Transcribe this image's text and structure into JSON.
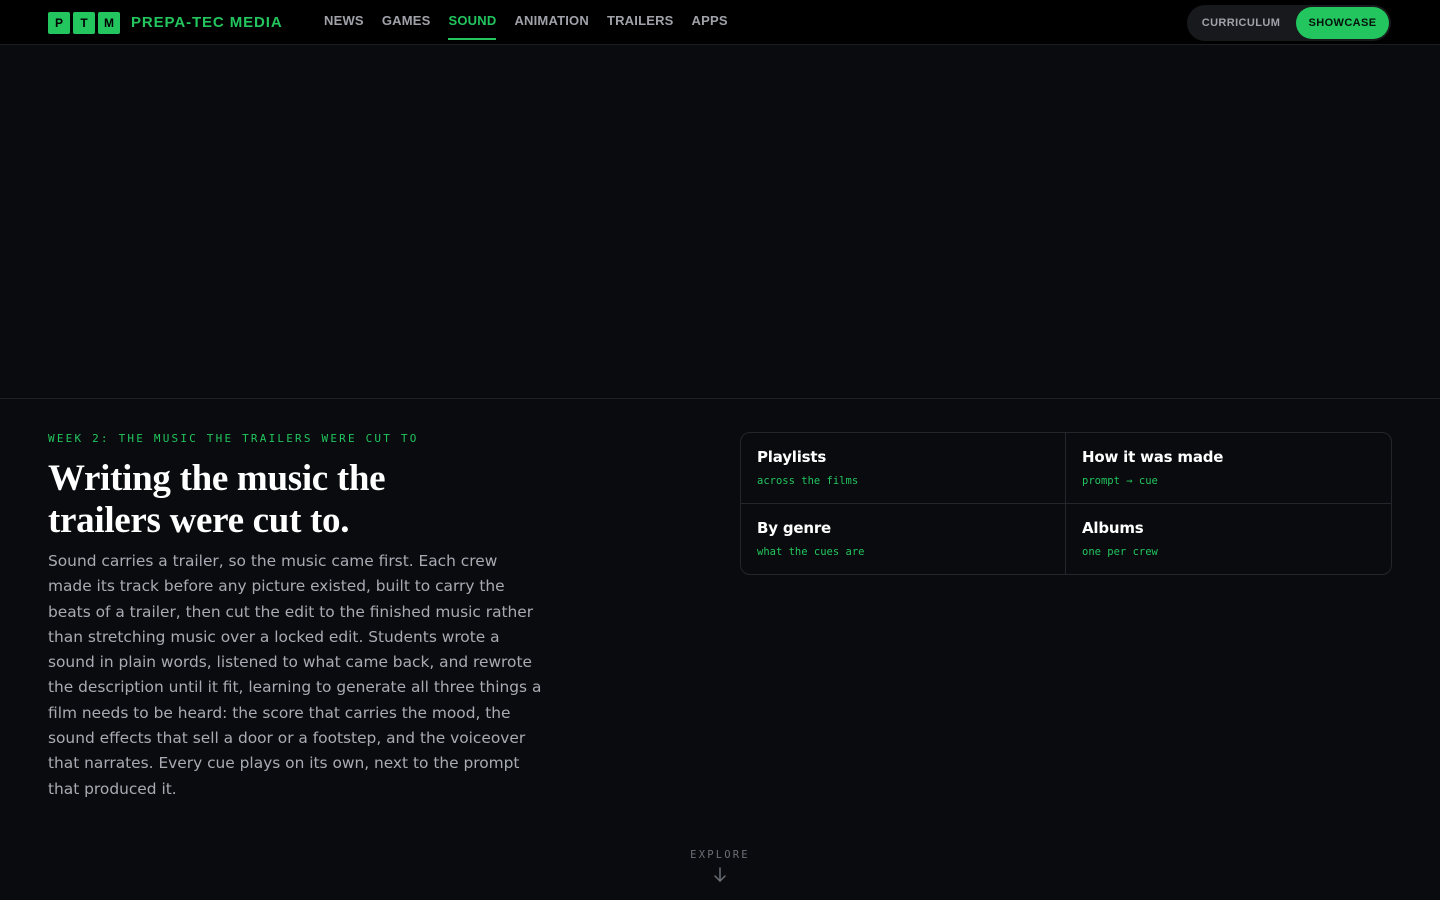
{
  "brand": {
    "tiles": [
      "P",
      "T",
      "M"
    ],
    "name": "PREPA-TEC MEDIA",
    "accent_color": "#22c55e"
  },
  "nav": {
    "items": [
      {
        "label": "NEWS",
        "active": false
      },
      {
        "label": "GAMES",
        "active": false
      },
      {
        "label": "SOUND",
        "active": true
      },
      {
        "label": "ANIMATION",
        "active": false
      },
      {
        "label": "TRAILERS",
        "active": false
      },
      {
        "label": "APPS",
        "active": false
      }
    ]
  },
  "mode_toggle": {
    "curriculum_label": "CURRICULUM",
    "showcase_label": "SHOWCASE",
    "selected": "SHOWCASE"
  },
  "intro": {
    "eyebrow": "WEEK 2: THE MUSIC THE TRAILERS WERE CUT TO",
    "headline": "Writing the music the trailers were cut to.",
    "body": "Sound carries a trailer, so the music came first. Each crew made its track before any picture existed, built to carry the beats of a trailer, then cut the edit to the finished music rather than stretching music over a locked edit. Students wrote a sound in plain words, listened to what came back, and rewrote the description until it fit, learning to generate all three things a film needs to be heard: the score that carries the mood, the sound effects that sell a door or a footstep, and the voiceover that narrates. Every cue plays on its own, next to the prompt that produced it."
  },
  "cards": [
    {
      "title": "Playlists",
      "subtitle": "across the films"
    },
    {
      "title": "How it was made",
      "subtitle": "prompt → cue"
    },
    {
      "title": "By genre",
      "subtitle": "what the cues are"
    },
    {
      "title": "Albums",
      "subtitle": "one per crew"
    }
  ],
  "explore": {
    "label": "EXPLORE",
    "icon": "arrow-down-icon"
  }
}
